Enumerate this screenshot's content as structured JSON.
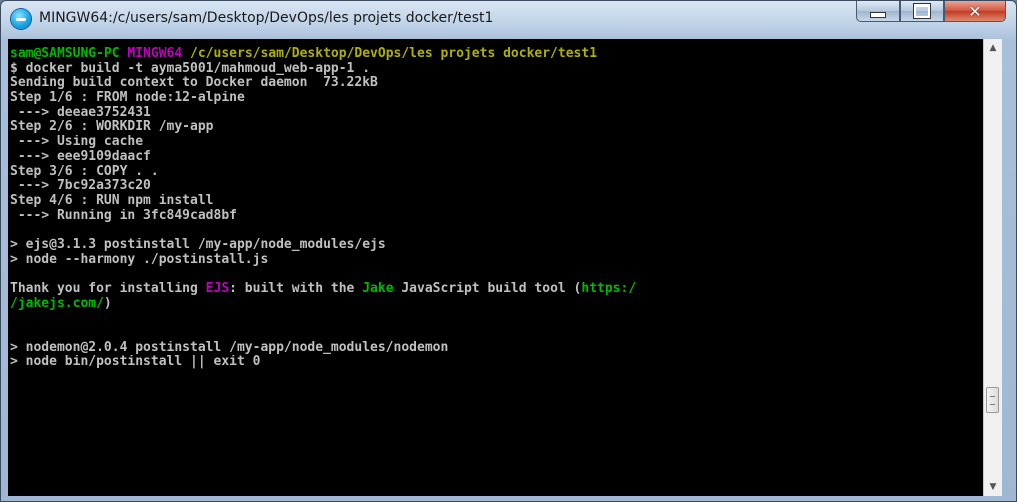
{
  "window": {
    "title": "MINGW64:/c/users/sam/Desktop/DevOps/les projets docker/test1",
    "icon": "mingw-terminal-icon",
    "controls": {
      "minimize": "minimize-icon",
      "maximize": "maximize-icon",
      "close": "close-icon"
    }
  },
  "terminal": {
    "prompt": {
      "user_host": "sam@SAMSUNG-PC",
      "env": "MINGW64",
      "path": "/c/users/sam/Desktop/DevOps/les projets docker/test1"
    },
    "lines": [
      "$ docker build -t ayma5001/mahmoud_web-app-1 .",
      "Sending build context to Docker daemon  73.22kB",
      "Step 1/6 : FROM node:12-alpine",
      " ---> deeae3752431",
      "Step 2/6 : WORKDIR /my-app",
      " ---> Using cache",
      " ---> eee9109daacf",
      "Step 3/6 : COPY . .",
      " ---> 7bc92a373c20",
      "Step 4/6 : RUN npm install",
      " ---> Running in 3fc849cad8bf",
      "",
      "> ejs@3.1.3 postinstall /my-app/node_modules/ejs",
      "> node --harmony ./postinstall.js",
      ""
    ],
    "thanks": {
      "prefix": "Thank you for installing ",
      "ejs": "EJS",
      "middle": ": built with the ",
      "jake": "Jake",
      "suffix": " JavaScript build tool (",
      "url_part1": "https:/",
      "url_part2": "/jakejs.com/",
      "url_close": ")"
    },
    "tail_lines": [
      "",
      "",
      "> nodemon@2.0.4 postinstall /my-app/node_modules/nodemon",
      "> node bin/postinstall || exit 0"
    ]
  },
  "colors": {
    "prompt_user": "#00b800",
    "prompt_env": "#c000c0",
    "prompt_path": "#b0b000",
    "text": "#c0c0c0"
  }
}
